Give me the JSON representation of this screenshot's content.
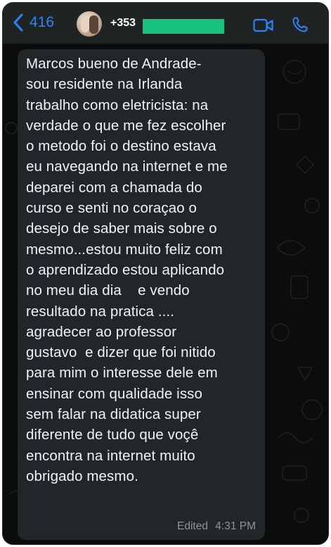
{
  "header": {
    "back_count": "416",
    "contact_name": "+353",
    "icons": {
      "back": "chevron-left-icon",
      "video": "video-camera-icon",
      "call": "phone-icon"
    },
    "accent_color": "#2b86f5"
  },
  "message": {
    "lines": [
      "Marcos bueno de Andrade-",
      "sou residente na Irlanda",
      "trabalho como eletricista: na",
      "verdade o que me fez escolher",
      "o metodo foi o destino estava",
      "eu navegando na internet e me",
      "deparei com a chamada do",
      "curso e senti no coraçao o",
      "desejo de saber mais sobre o",
      "mesmo...estou muito feliz com",
      "o aprendizado estou aplicando",
      "no meu dia dia    e vendo",
      "resultado na pratica ....",
      "agradecer ao professor",
      "gustavo  e dizer que foi nitido",
      "para mim o interesse dele em",
      "ensinar com qualidade isso",
      "sem falar na didatica super",
      "diferente de tudo que voçê",
      "encontra na internet muito",
      "obrigado mesmo."
    ],
    "edited_label": "Edited",
    "time": "4:31 PM"
  }
}
